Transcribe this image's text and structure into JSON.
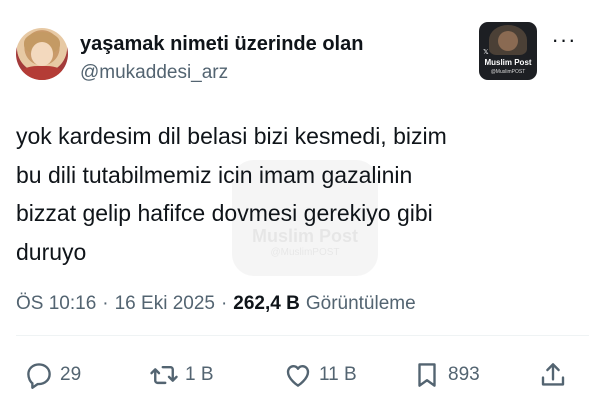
{
  "author": {
    "display_name": "yaşamak nimeti üzerinde olan",
    "handle": "@mukaddesi_arz"
  },
  "overlay": {
    "brand": "Muslim Post",
    "brand_handle": "@MuslimPOST",
    "x_icon": "x-logo-icon"
  },
  "tweet": {
    "lines": [
      "yok kardesim dil belasi bizi kesmedi, bizim",
      "bu dili tutabilmemiz icin imam gazalinin",
      "bizzat gelip hafifce dovmesi gerekiyo gibi",
      "duruyo"
    ]
  },
  "meta": {
    "time": "ÖS 10:16",
    "sep1": "·",
    "date": "16 Eki 2025",
    "sep2": "·",
    "views_count": "262,4 B",
    "views_label": "Görüntüleme"
  },
  "actions": {
    "replies": "29",
    "retweets": "1 B",
    "likes": "11 B",
    "bookmarks": "893"
  },
  "icons": {
    "more": "more-icon",
    "reply": "reply-icon",
    "retweet": "retweet-icon",
    "like": "heart-icon",
    "bookmark": "bookmark-icon",
    "share": "share-icon"
  },
  "colors": {
    "text": "#0f1419",
    "secondary": "#536471",
    "divider": "#eff3f4"
  }
}
